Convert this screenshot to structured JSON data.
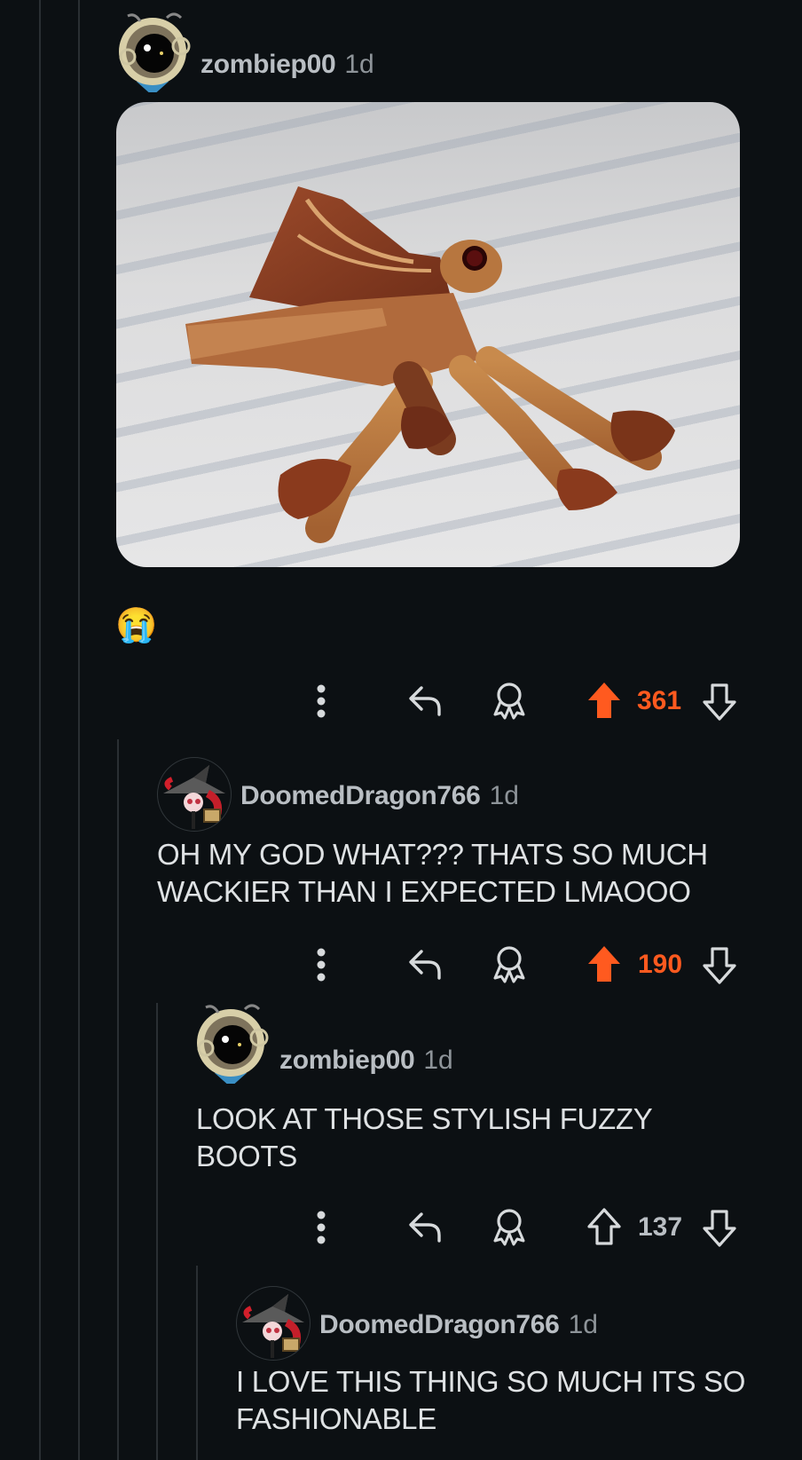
{
  "colors": {
    "background": "#0c1013",
    "thread_line": "#2a2f33",
    "upvoted": "#ff5a1f",
    "text": "#dfe2e4",
    "meta": "#8e9499"
  },
  "comments": [
    {
      "username": "zombiep00",
      "time": "1d",
      "avatar": "zombie-avatar",
      "image": "moth-photo",
      "emoji": "😭",
      "score": "361",
      "voted": "up"
    },
    {
      "username": "DoomedDragon766",
      "time": "1d",
      "avatar": "witch-avatar",
      "text": "OH MY GOD WHAT??? THATS SO MUCH WACKIER THAN I EXPECTED LMAOOO",
      "score": "190",
      "voted": "up"
    },
    {
      "username": "zombiep00",
      "time": "1d",
      "avatar": "zombie-avatar",
      "text": "LOOK AT THOSE STYLISH FUZZY BOOTS",
      "score": "137",
      "voted": "none"
    },
    {
      "username": "DoomedDragon766",
      "time": "1d",
      "avatar": "witch-avatar",
      "text": "I LOVE THIS THING SO MUCH ITS SO FASHIONABLE"
    }
  ],
  "icons": [
    "more-icon",
    "reply-icon",
    "award-icon",
    "upvote-icon",
    "downvote-icon"
  ]
}
